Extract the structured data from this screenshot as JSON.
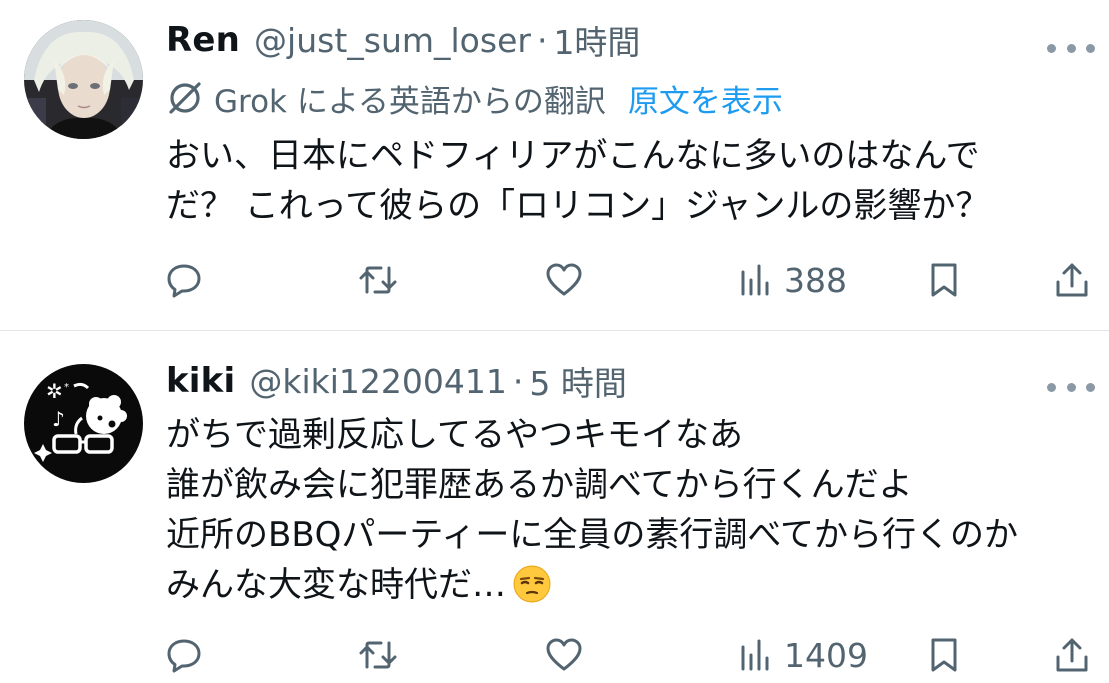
{
  "posts": [
    {
      "name": "Ren",
      "handle": "@just_sum_loser",
      "separator": "·",
      "time": "1時間",
      "translation": {
        "label": "Grok による英語からの翻訳",
        "show_original": "原文を表示"
      },
      "text_lines": [
        "おい、日本にペドフィリアがこんなに多いのはなんで",
        "だ？ これって彼らの「ロリコン」ジャンルの影響か？"
      ],
      "views": "388"
    },
    {
      "name": "kiki",
      "handle": "@kiki12200411",
      "separator": "·",
      "time": "5 時間",
      "text_lines": [
        "がちで過剰反応してるやつキモイなあ",
        "誰が飲み会に犯罪歴あるか調べてから行くんだよ",
        "近所のBBQパーティーに全員の素行調べてから行くのか",
        "みんな大変な時代だ…"
      ],
      "emoji": "unamused-face",
      "views": "1409"
    }
  ],
  "icons": {
    "more": "more-icon",
    "grok": "grok-icon",
    "reply": "reply-icon",
    "retweet": "retweet-icon",
    "like": "heart-icon",
    "views": "views-icon",
    "bookmark": "bookmark-icon",
    "share": "share-icon"
  },
  "colors": {
    "text": "#0f1419",
    "secondary": "#536471",
    "link": "#1d9bf0",
    "divider": "#e3e6e8"
  }
}
